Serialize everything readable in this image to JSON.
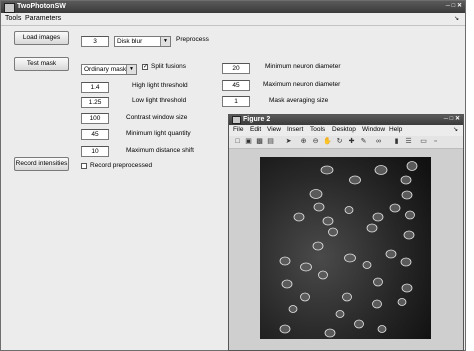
{
  "main": {
    "title": "TwoPhotonSW",
    "menu": [
      "Tools",
      "Parameters"
    ],
    "load_images": "Load images",
    "test_mask": "Test mask",
    "record_intensities": "Record intensities",
    "filter_size": "3",
    "filter_type": "Disk blur",
    "preprocess_label": "Preprocess",
    "mask_type": "Ordinary mask",
    "split_fusions_label": "Split fusions",
    "split_fusions_checked": true,
    "record_preprocessed_label": "Record preprocessed",
    "record_preprocessed_checked": false,
    "params_left": [
      {
        "value": "1.4",
        "label": "High light threshold"
      },
      {
        "value": "1.25",
        "label": "Low light threshold"
      },
      {
        "value": "100",
        "label": "Contrast window size"
      },
      {
        "value": "45",
        "label": "Minimum light quantity"
      },
      {
        "value": "10",
        "label": "Maximum distance shift"
      }
    ],
    "params_right": [
      {
        "value": "20",
        "label": "Minimum neuron diameter"
      },
      {
        "value": "45",
        "label": "Maximum neuron diameter"
      },
      {
        "value": "1",
        "label": "Mask averaging size"
      }
    ]
  },
  "figure": {
    "title": "Figure 2",
    "menu": [
      "File",
      "Edit",
      "View",
      "Insert",
      "Tools",
      "Desktop",
      "Window",
      "Help"
    ],
    "toolbar_icons": [
      "new-file-icon",
      "open-icon",
      "save-icon",
      "print-icon",
      "select-arrow-icon",
      "zoom-in-icon",
      "zoom-out-icon",
      "pan-hand-icon",
      "rotate-icon",
      "data-cursor-icon",
      "brush-icon",
      "link-icon",
      "colorbar-icon",
      "legend-icon",
      "hide-tools-icon",
      "dock-icon"
    ]
  }
}
